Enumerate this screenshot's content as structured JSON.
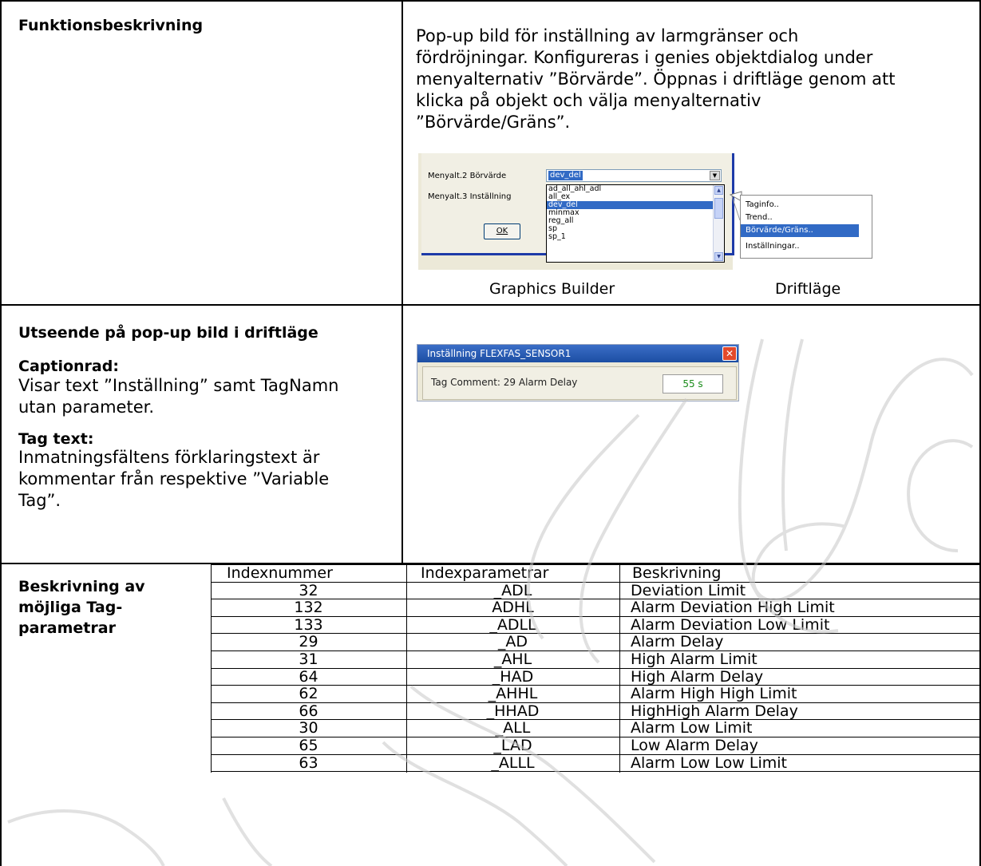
{
  "sections": {
    "function": {
      "label": "Funktionsbeskrivning",
      "description": "Pop-up bild för inställning av larmgränser och fördröjningar. Konfigureras i genies objektdialog under menyalternativ ”Börvärde”. Öppnas i driftläge genom att klicka på objekt och välja menyalternativ ”Börvärde/Gräns”.",
      "description_lines": [
        "Pop-up bild för inställning av larmgränser och",
        "fördröjningar. Konfigureras i genies objektdialog under",
        "menyalternativ ”Börvärde”. Öppnas i driftläge genom att",
        "klicka på objekt och välja menyalternativ",
        "”Börvärde/Gräns”."
      ],
      "graphics_builder": {
        "row1_label": "Menyalt.2 Börvärde",
        "row2_label": "Menyalt.3 Inställning",
        "combo_value": "dev_del",
        "list_items": [
          "ad_all_ahl_adl",
          "all_ex",
          "dev_del",
          "minmax",
          "reg_all",
          "sp",
          "sp_1"
        ],
        "selected_item": "dev_del",
        "ok_label": "OK",
        "caption": "Graphics Builder"
      },
      "driftlage": {
        "menu_items": [
          "Taginfo..",
          "Trend..",
          "Börvärde/Gräns..",
          "Inställningar.."
        ],
        "selected_item": "Börvärde/Gräns..",
        "caption": "Driftläge"
      }
    },
    "appearance": {
      "title": "Utseende på pop-up bild i driftläge",
      "caption_heading": "Captionrad:",
      "caption_lines": [
        "Visar text ”Inställning” samt TagNamn",
        "utan parameter."
      ],
      "tagtext_heading": "Tag text:",
      "tagtext_lines": [
        "Inmatningsfältens förklaringstext är",
        "kommentar från respektive ”Variable",
        "Tag”."
      ],
      "popup": {
        "title": "Inställning FLEXFAS_SENSOR1",
        "field_label": "Tag Comment: 29 Alarm Delay",
        "field_value": "55 s"
      }
    },
    "parameters": {
      "label_lines": [
        "Beskrivning av",
        "möjliga Tag-",
        "parametrar"
      ],
      "headers": [
        "Indexnummer",
        "Indexparametrar",
        "Beskrivning"
      ],
      "rows": [
        [
          "32",
          "_ADL",
          "Deviation Limit"
        ],
        [
          "132",
          "ADHL",
          "Alarm Deviation High Limit"
        ],
        [
          "133",
          "_ADLL",
          "Alarm Deviation Low Limit"
        ],
        [
          "29",
          "_AD",
          "Alarm Delay"
        ],
        [
          "31",
          "_AHL",
          "High Alarm Limit"
        ],
        [
          "64",
          "_HAD",
          "High Alarm Delay"
        ],
        [
          "62",
          "_AHHL",
          "Alarm High High Limit"
        ],
        [
          "66",
          "_HHAD",
          "HighHigh Alarm Delay"
        ],
        [
          "30",
          "_ALL",
          "Alarm Low Limit"
        ],
        [
          "65",
          "_LAD",
          "Low Alarm Delay"
        ],
        [
          "63",
          "_ALLL",
          "Alarm Low Low Limit"
        ]
      ]
    }
  },
  "colors": {
    "selection": "#316ac5",
    "caption_bar": "#1c4ea3",
    "value_green": "#1a8c1a",
    "watermark": "#c8c8c8"
  }
}
